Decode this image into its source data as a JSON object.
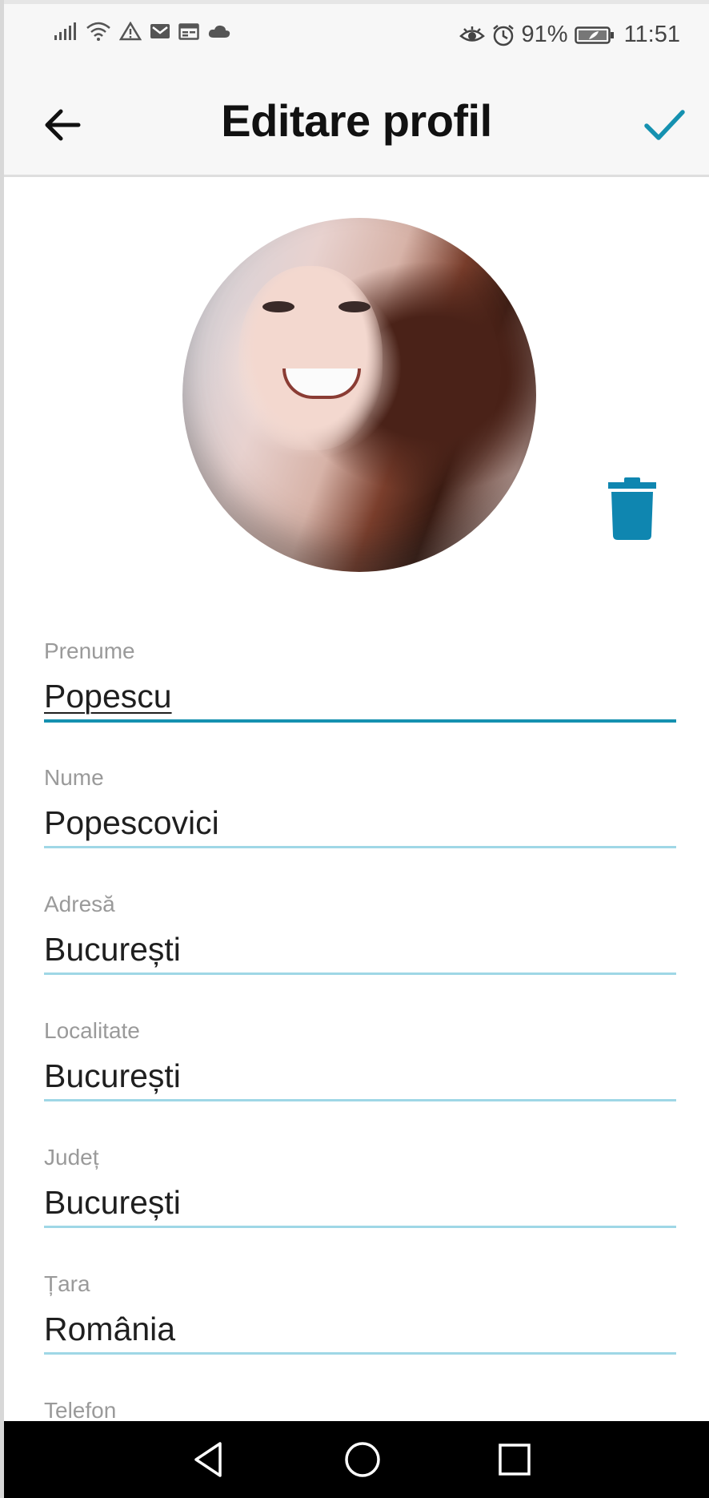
{
  "status_bar": {
    "battery": "91%",
    "time": "11:51",
    "icons": [
      "signal-icon",
      "wifi-icon",
      "warning-icon",
      "mail-icon",
      "calendar-icon",
      "cloud-icon",
      "eye-icon",
      "alarm-icon",
      "battery-icon"
    ]
  },
  "header": {
    "title": "Editare profil",
    "back_icon": "arrow-left-icon",
    "save_icon": "check-icon"
  },
  "profile": {
    "delete_icon": "trash-icon"
  },
  "form": {
    "fields": [
      {
        "label": "Prenume",
        "value": "Popescu"
      },
      {
        "label": "Nume",
        "value": "Popescovici"
      },
      {
        "label": "Adresă",
        "value": "București"
      },
      {
        "label": "Localitate",
        "value": "București"
      },
      {
        "label": "Județ",
        "value": "București"
      },
      {
        "label": "Țara",
        "value": "România"
      },
      {
        "label": "Telefon",
        "value": ""
      }
    ]
  },
  "colors": {
    "accent": "#1591b0",
    "field_underline": "#9fd7e6",
    "trash": "#0f86b0"
  },
  "nav_bar": {
    "icons": [
      "back-triangle-icon",
      "home-circle-icon",
      "recents-square-icon"
    ]
  }
}
